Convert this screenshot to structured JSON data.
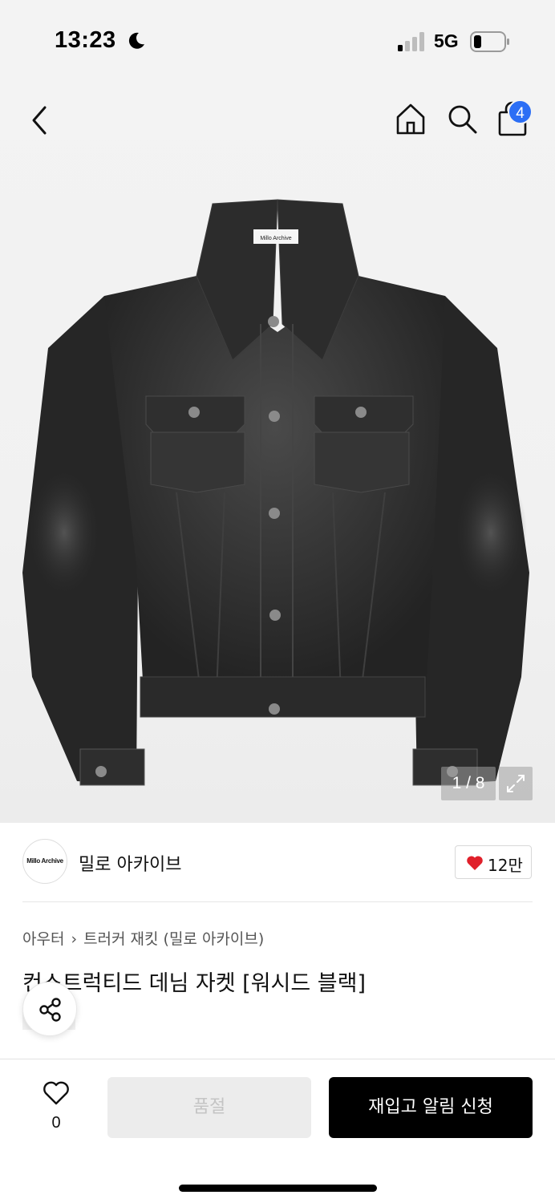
{
  "status_bar": {
    "time": "13:23",
    "network": "5G",
    "icons": [
      "moon-icon",
      "signal-icon",
      "battery-icon"
    ]
  },
  "nav": {
    "icons": [
      "back-chevron-icon",
      "home-icon",
      "search-icon",
      "shopping-bag-icon"
    ],
    "cart_badge": "4",
    "badge_color": "#2b6ef5"
  },
  "gallery": {
    "label_on_tag": "Millo Archive",
    "counter": "1 / 8",
    "expand_icon": "expand-icon"
  },
  "brand": {
    "logo_text": "Millo Archive",
    "name": "밀로 아카이브",
    "like_count": "12만",
    "heart_color": "#e0202a"
  },
  "product": {
    "breadcrumb": [
      "아우터",
      "트러커 재킷 (밀로 아카이브)"
    ],
    "title": "컨스트럭티드 데님 자켓 [워시드 블랙]",
    "share_icon": "share-icon"
  },
  "bottom_bar": {
    "wish_count": "0",
    "soldout_label": "품절",
    "restock_label": "재입고 알림 신청"
  }
}
